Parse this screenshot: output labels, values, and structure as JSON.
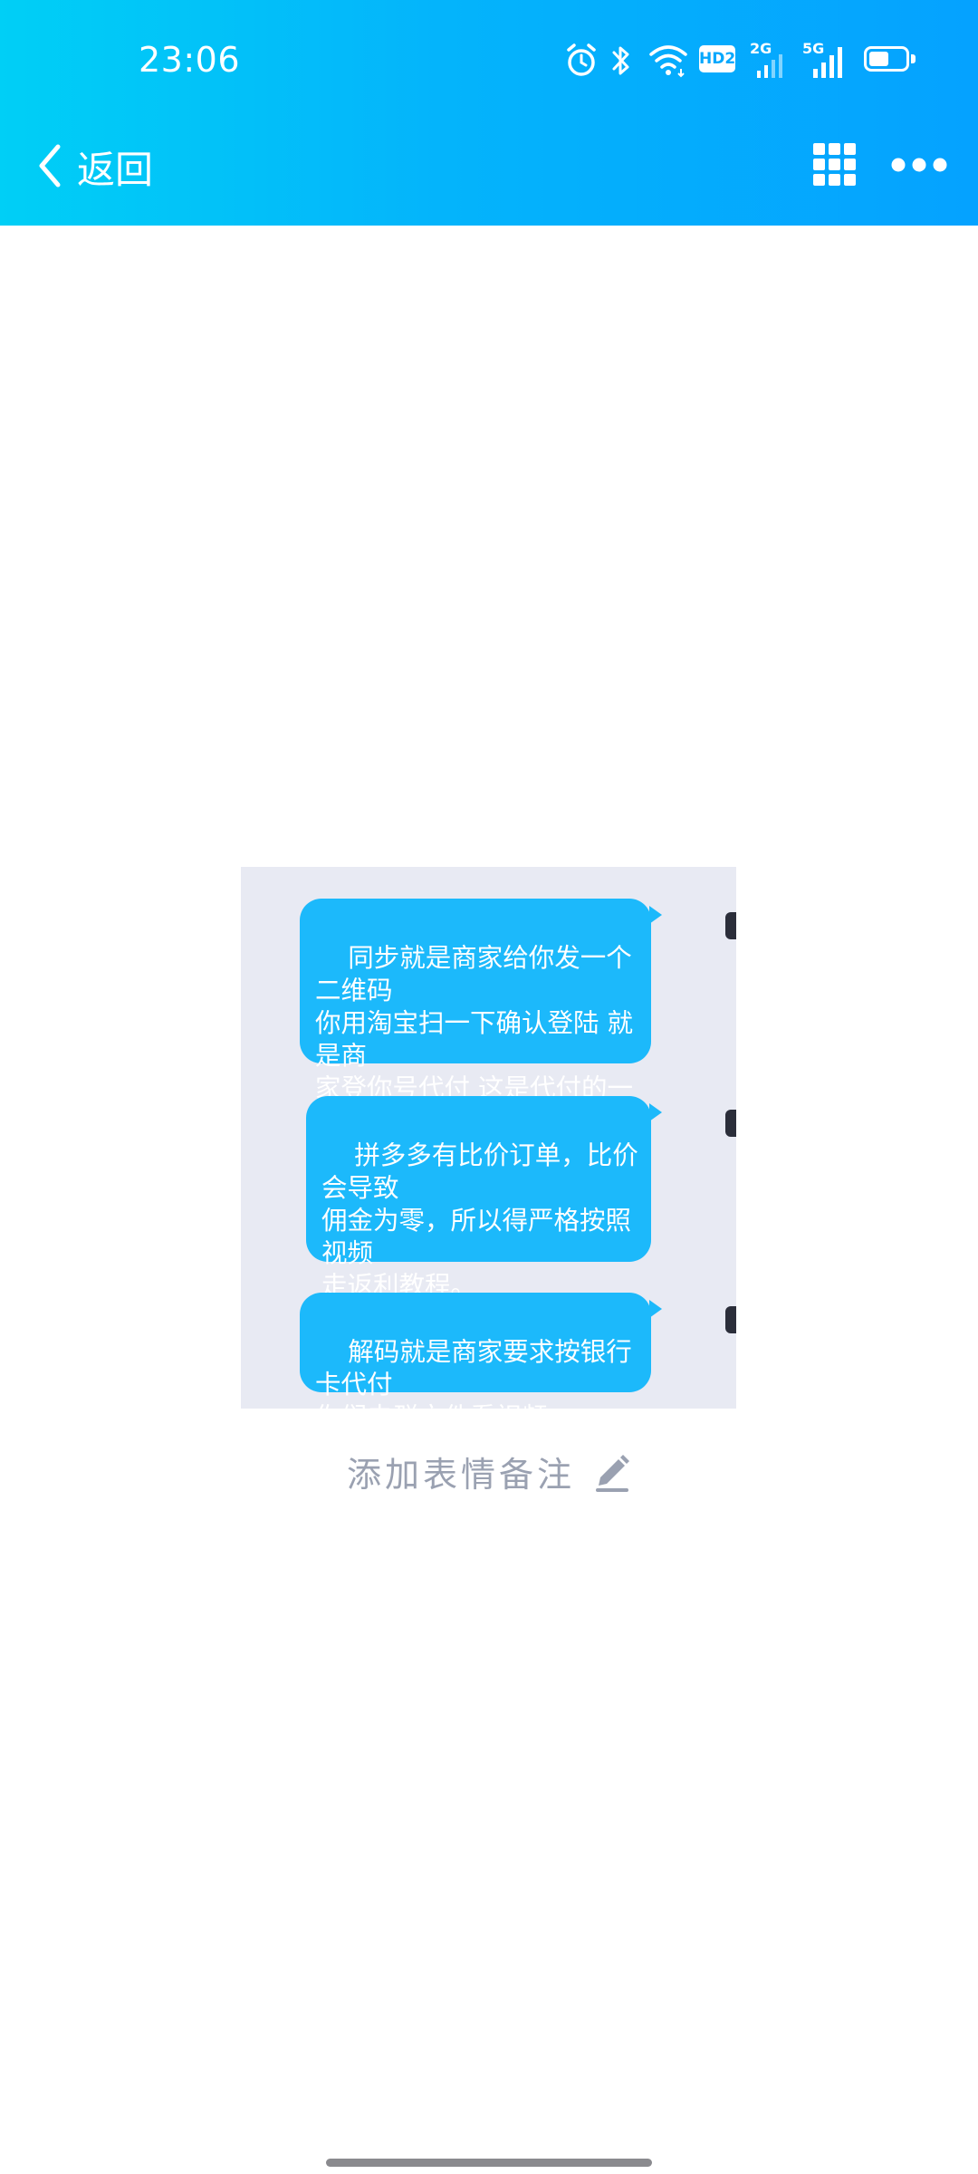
{
  "status_bar": {
    "time": "23:06",
    "icons": [
      "alarm-icon",
      "bluetooth-icon",
      "wifi-icon",
      "hd2-icon",
      "signal-2g-icon",
      "signal-5g-icon",
      "battery-icon"
    ],
    "hd_label": "HD2",
    "net1_label": "2G",
    "net2_label": "5G",
    "battery_level": 0.55
  },
  "header": {
    "back_label": "返回",
    "grid_icon": "grid-icon",
    "more_icon": "more-icon",
    "bar_color": "#05a8fd"
  },
  "image": {
    "background": "#e8eaf3",
    "bubble_color": "#1cb9fb",
    "messages": [
      {
        "text": "同步就是商家给你发一个二维码\n你用淘宝扫一下确认登陆 就是商\n家登你号代付 这是代付的一种方\n式"
      },
      {
        "text": "拼多多有比价订单，比价会导致\n佣金为零，所以得严格按照视频\n走返利教程。\n做拼多多任务最少准备两个账号"
      },
      {
        "text": "解码就是商家要求按银行卡代付\n你们去群文件看视频"
      }
    ]
  },
  "note": {
    "label": "添加表情备注",
    "icon": "edit-pencil-icon"
  }
}
